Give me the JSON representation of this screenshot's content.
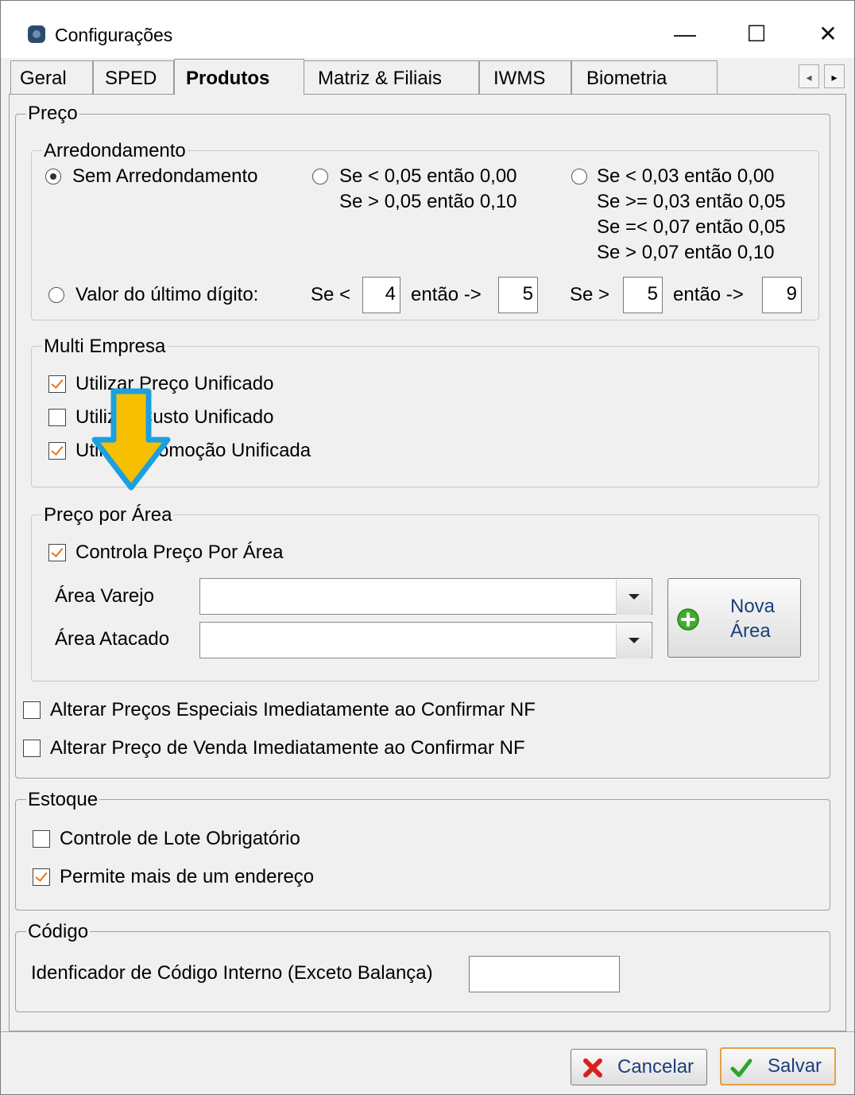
{
  "window": {
    "title": "Configurações",
    "minimize_symbol": "—",
    "maximize_symbol": "☐",
    "close_symbol": "✕"
  },
  "tabs": [
    {
      "label": "Geral"
    },
    {
      "label": "SPED"
    },
    {
      "label": "Produtos"
    },
    {
      "label": "Matriz & Filiais"
    },
    {
      "label": "IWMS"
    },
    {
      "label": "Biometria"
    }
  ],
  "active_tab": "Produtos",
  "tab_scroll": {
    "left": "◂",
    "right": "▸"
  },
  "preco": {
    "legend": "Preço",
    "arredondamento": {
      "legend": "Arredondamento",
      "option_sem": "Sem Arredondamento",
      "option_005_line1": "Se < 0,05 então 0,00",
      "option_005_line2": "Se > 0,05 então 0,10",
      "option_003_line1": "Se < 0,03 então 0,00",
      "option_003_line2": "Se >= 0,03 então 0,05",
      "option_003_line3": "Se =< 0,07 então 0,05",
      "option_003_line4": "Se > 0,07 então 0,10",
      "option_ultimo_digito": "Valor do último dígito:",
      "se_menor_label": "Se <",
      "se_menor_value": "4",
      "entao1_label": "então ->",
      "entao1_value": "5",
      "se_maior_label": "Se >",
      "se_maior_value": "5",
      "entao2_label": "então ->",
      "entao2_value": "9",
      "selected": "Sem Arredondamento"
    },
    "multi_empresa": {
      "legend": "Multi Empresa",
      "items": [
        {
          "label": "Utilizar Preço Unificado",
          "checked": true
        },
        {
          "label": "Utilizar Custo Unificado",
          "checked": false
        },
        {
          "label": "Utilizar Promoção Unificada",
          "checked": true
        }
      ]
    },
    "preco_por_area": {
      "legend": "Preço por Área",
      "controla_label": "Controla Preço Por Área",
      "controla_checked": true,
      "area_varejo_label": "Área Varejo",
      "area_varejo_value": "",
      "area_atacado_label": "Área Atacado",
      "area_atacado_value": "",
      "nova_area_line1": "Nova",
      "nova_area_line2": "Área"
    },
    "alterar_especiais": {
      "label": "Alterar Preços Especiais Imediatamente ao Confirmar NF",
      "checked": false
    },
    "alterar_venda": {
      "label": "Alterar Preço de Venda Imediatamente ao Confirmar NF",
      "checked": false
    }
  },
  "estoque": {
    "legend": "Estoque",
    "controle_lote": {
      "label": "Controle de Lote Obrigatório",
      "checked": false
    },
    "mais_endereco": {
      "label": "Permite mais de um endereço",
      "checked": true
    }
  },
  "codigo": {
    "legend": "Código",
    "identificador_label": "Idenficador de Código Interno (Exceto Balança)",
    "identificador_value": ""
  },
  "footer": {
    "cancel_label": "Cancelar",
    "save_label": "Salvar"
  },
  "colors": {
    "annotation_arrow_fill": "#f6c000",
    "annotation_arrow_stroke": "#1aa0e0",
    "check_mark": "#e8731c"
  }
}
